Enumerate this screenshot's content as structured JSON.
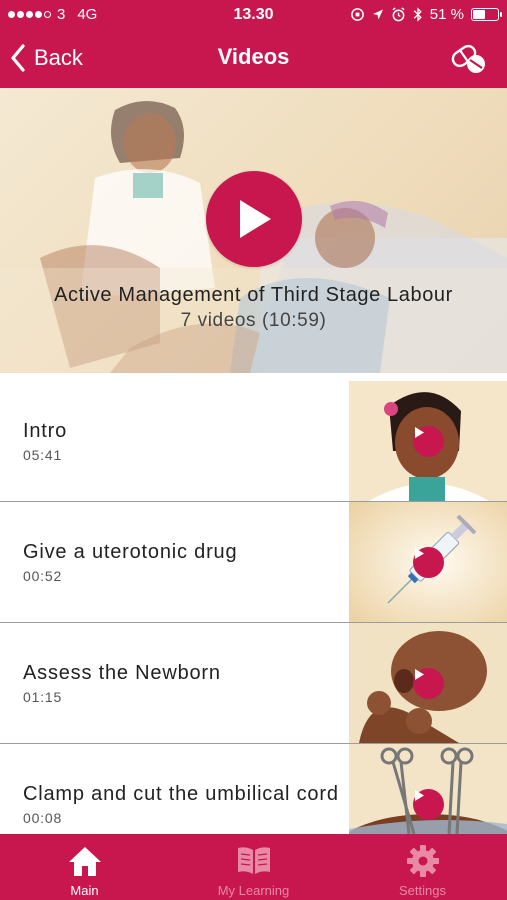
{
  "status_bar": {
    "carrier": "3",
    "network": "4G",
    "time": "13.30",
    "battery": "51 %",
    "signal_bars": 4,
    "battery_level": 0.51
  },
  "nav": {
    "back_label": "Back",
    "title": "Videos",
    "action_icon": "pills-icon"
  },
  "hero": {
    "title": "Active Management of Third Stage Labour",
    "subtitle": "7 videos (10:59)"
  },
  "videos": [
    {
      "title": "Intro",
      "duration": "05:41",
      "thumb_icon": "nurse-portrait"
    },
    {
      "title": "Give a uterotonic drug",
      "duration": "00:52",
      "thumb_icon": "syringe"
    },
    {
      "title": "Assess the Newborn",
      "duration": "01:15",
      "thumb_icon": "newborn"
    },
    {
      "title": "Clamp and cut the umbilical cord",
      "duration": "00:08",
      "thumb_icon": "clamps"
    }
  ],
  "tabs": [
    {
      "label": "Main",
      "icon": "home-icon",
      "active": true
    },
    {
      "label": "My Learning",
      "icon": "book-icon",
      "active": false
    },
    {
      "label": "Settings",
      "icon": "gear-icon",
      "active": false
    }
  ],
  "colors": {
    "brand": "#c8174f",
    "inactive_tab": "#e88aa5",
    "divider": "#9c9c9c"
  }
}
